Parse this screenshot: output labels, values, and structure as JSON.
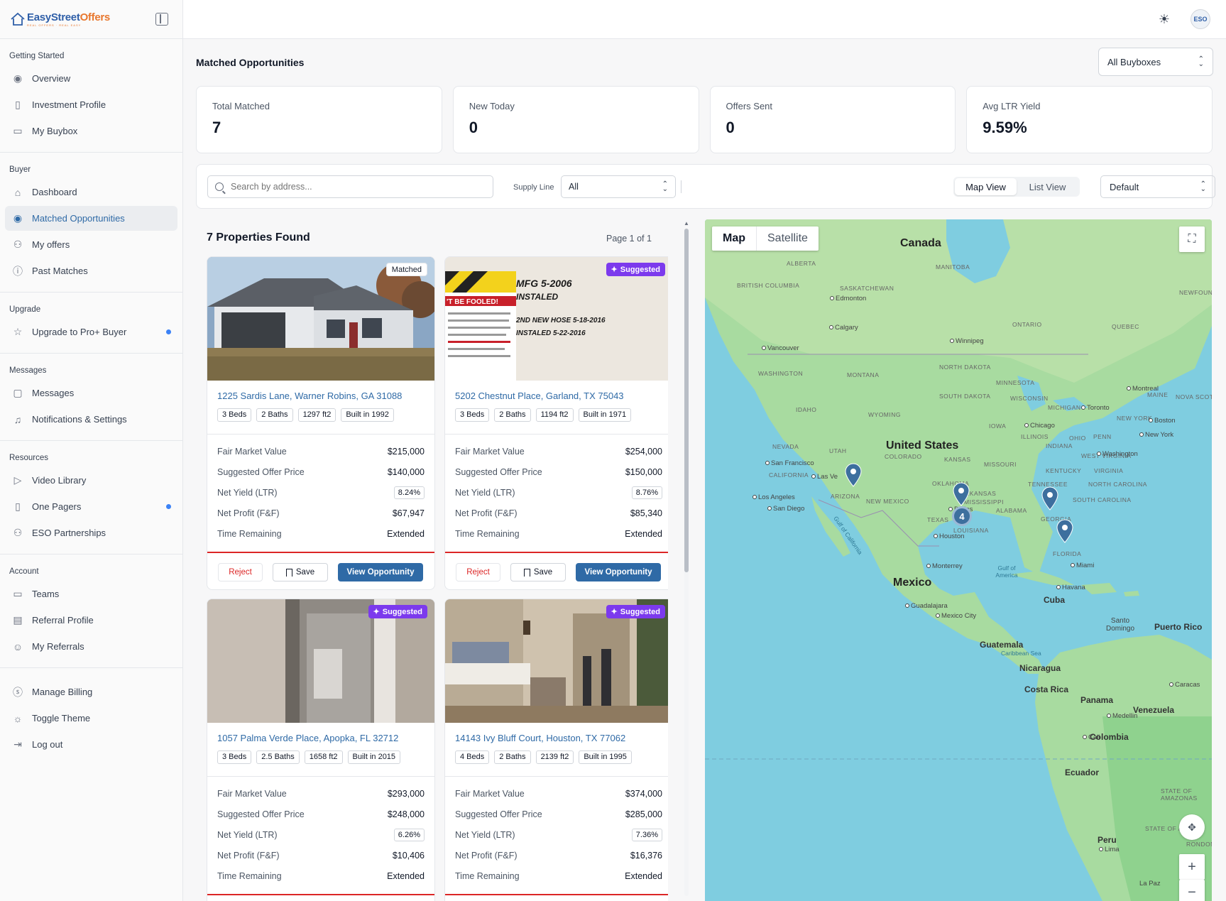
{
  "app": {
    "logo_text_a": "EasyStreet",
    "logo_text_b": "Offers",
    "logo_tagline": "REAL OFFERS · REAL EASY",
    "avatar_text": "ESO"
  },
  "sidebar": {
    "sections": [
      {
        "title": "Getting Started",
        "items": [
          {
            "label": "Overview",
            "icon": "eye-icon"
          },
          {
            "label": "Investment Profile",
            "icon": "book-icon"
          },
          {
            "label": "My Buybox",
            "icon": "briefcase-icon"
          }
        ]
      },
      {
        "title": "Buyer",
        "items": [
          {
            "label": "Dashboard",
            "icon": "home-icon"
          },
          {
            "label": "Matched Opportunities",
            "icon": "eye-icon",
            "active": true
          },
          {
            "label": "My offers",
            "icon": "handshake-icon"
          },
          {
            "label": "Past Matches",
            "icon": "alert-circle-icon"
          }
        ]
      },
      {
        "title": "Upgrade",
        "items": [
          {
            "label": "Upgrade to Pro+ Buyer",
            "icon": "star-icon",
            "dot": true
          }
        ]
      },
      {
        "title": "Messages",
        "items": [
          {
            "label": "Messages",
            "icon": "message-icon"
          },
          {
            "label": "Notifications & Settings",
            "icon": "bell-icon"
          }
        ]
      },
      {
        "title": "Resources",
        "items": [
          {
            "label": "Video Library",
            "icon": "play-icon"
          },
          {
            "label": "One Pagers",
            "icon": "book-icon",
            "dot": true
          },
          {
            "label": "ESO Partnerships",
            "icon": "handshake-icon"
          }
        ]
      },
      {
        "title": "Account",
        "items": [
          {
            "label": "Teams",
            "icon": "briefcase-icon"
          },
          {
            "label": "Referral Profile",
            "icon": "id-badge-icon"
          },
          {
            "label": "My Referrals",
            "icon": "users-icon"
          }
        ]
      }
    ],
    "bottom": [
      {
        "label": "Manage Billing",
        "icon": "dollar-icon"
      },
      {
        "label": "Toggle Theme",
        "icon": "sun-icon"
      },
      {
        "label": "Log out",
        "icon": "logout-icon"
      }
    ]
  },
  "main": {
    "title": "Matched Opportunities",
    "buybox_select": "All Buyboxes",
    "stats": [
      {
        "label": "Total Matched",
        "value": "7"
      },
      {
        "label": "New Today",
        "value": "0"
      },
      {
        "label": "Offers Sent",
        "value": "0"
      },
      {
        "label": "Avg LTR Yield",
        "value": "9.59%"
      }
    ],
    "filters": {
      "search_placeholder": "Search by address...",
      "supply_label": "Supply Line",
      "supply_value": "All",
      "map_view": "Map View",
      "list_view": "List View",
      "sort_value": "Default"
    },
    "found_text": "7 Properties Found",
    "page_text": "Page 1 of 1",
    "labels": {
      "fmv": "Fair Market Value",
      "offer": "Suggested Offer Price",
      "yield": "Net Yield (LTR)",
      "profit": "Net Profit (F&F)",
      "time": "Time Remaining",
      "reject": "Reject",
      "save": "Save",
      "view": "View Opportunity"
    },
    "properties": [
      {
        "badge": "Matched",
        "address": "1225 Sardis Lane, Warner Robins, GA 31088",
        "beds": "3 Beds",
        "baths": "2 Baths",
        "sqft": "1297 ft2",
        "built": "Built in 1992",
        "fmv": "$215,000",
        "offer": "$140,000",
        "yield": "8.24%",
        "profit": "$67,947",
        "time": "Extended"
      },
      {
        "badge": "Suggested",
        "address": "5202 Chestnut Place, Garland, TX 75043",
        "beds": "3 Beds",
        "baths": "2 Baths",
        "sqft": "1194 ft2",
        "built": "Built in 1971",
        "fmv": "$254,000",
        "offer": "$150,000",
        "yield": "8.76%",
        "profit": "$85,340",
        "time": "Extended"
      },
      {
        "badge": "Suggested",
        "address": "1057 Palma Verde Place, Apopka, FL 32712",
        "beds": "3 Beds",
        "baths": "2.5 Baths",
        "sqft": "1658 ft2",
        "built": "Built in 2015",
        "fmv": "$293,000",
        "offer": "$248,000",
        "yield": "6.26%",
        "profit": "$10,406",
        "time": "Extended"
      },
      {
        "badge": "Suggested",
        "address": "14143 Ivy Bluff Court, Houston, TX 77062",
        "beds": "4 Beds",
        "baths": "2 Baths",
        "sqft": "2139 ft2",
        "built": "Built in 1995",
        "fmv": "$374,000",
        "offer": "$285,000",
        "yield": "7.36%",
        "profit": "$16,376",
        "time": "Extended"
      }
    ],
    "photo_text": {
      "sign_left": "'T BE FOOLED!",
      "sign_right_1": "MFG 5-2006",
      "sign_right_2": "INSTALED",
      "sign_right_3": "2ND NEW HOSE 5-18-2016",
      "sign_right_4": "INSTALED 5-22-2016"
    }
  },
  "map": {
    "type_map": "Map",
    "type_satellite": "Satellite",
    "cluster_count": "4",
    "countries": [
      "Canada",
      "United States",
      "Mexico"
    ],
    "labels": {
      "british_columbia": "BRITISH COLUMBIA",
      "alberta": "ALBERTA",
      "saskatchewan": "SASKATCHEWAN",
      "manitoba": "MANITOBA",
      "ontario": "ONTARIO",
      "quebec": "QUEBEC",
      "newfoundland": "NEWFOUND LA",
      "washington": "WASHINGTON",
      "montana": "MONTANA",
      "north_dakota": "NORTH DAKOTA",
      "minnesota": "MINNESOTA",
      "south_dakota": "SOUTH DAKOTA",
      "wisconsin": "WISCONSIN",
      "michigan": "MICHIGAN",
      "maine": "MAINE",
      "nova_scotia": "NOVA SCOT",
      "idaho": "IDAHO",
      "wyoming": "WYOMING",
      "iowa": "IOWA",
      "illinois": "ILLINOIS",
      "indiana": "INDIANA",
      "ohio": "OHIO",
      "penn": "PENN",
      "new_york": "NEW YORK",
      "nevada": "NEVADA",
      "utah": "UTAH",
      "colorado": "COLORADO",
      "kansas": "KANSAS",
      "california": "CALIFORNIA",
      "missouri": "MISSOURI",
      "kentucky": "KENTUCKY",
      "west_virginia": "WEST VIRGINIA",
      "virginia": "VIRGINIA",
      "arizona": "ARIZONA",
      "new_mexico": "NEW MEXICO",
      "oklahoma": "OKLAHOMA",
      "arkansas": "ARKANSAS",
      "tennessee": "TENNESSEE",
      "north_carolina": "NORTH CAROLINA",
      "south_carolina": "SOUTH CAROLINA",
      "mississippi": "MISSISSIPPI",
      "alabama": "ALABAMA",
      "georgia": "GEORGIA",
      "texas": "TEXAS",
      "louisiana": "LOUISIANA",
      "florida": "FLORIDA",
      "gulf_california": "Gulf of California",
      "gulf_america": "Gulf of America",
      "caribbean": "Caribbean Sea",
      "cuba": "Cuba",
      "santo_domingo": "Santo Domingo",
      "puerto_rico": "Puerto Rico",
      "guatemala": "Guatemala",
      "nicaragua": "Nicaragua",
      "costa_rica": "Costa Rica",
      "panama": "Panama",
      "venezuela": "Venezuela",
      "colombia": "Colombia",
      "ecuador": "Ecuador",
      "peru": "Peru",
      "state_amazonas": "STATE OF AMAZONAS",
      "state_acre": "STATE OF ACRE",
      "rondonia": "RONDONI",
      "la_paz": "La Paz"
    },
    "cities": {
      "edmonton": "Edmonton",
      "calgary": "Calgary",
      "vancouver": "Vancouver",
      "winnipeg": "Winnipeg",
      "montreal": "Montreal",
      "toronto": "Toronto",
      "boston": "Boston",
      "chicago": "Chicago",
      "new_york": "New York",
      "washington": "Washington",
      "san_francisco": "San Francisco",
      "las_vegas": "Las Ve",
      "los_angeles": "Los Angeles",
      "san_diego": "San Diego",
      "dallas": "Dallas",
      "houston": "Houston",
      "miami": "Miami",
      "monterrey": "Monterrey",
      "guadalajara": "Guadalajara",
      "mexico_city": "Mexico City",
      "havana": "Havana",
      "caracas": "Caracas",
      "medellin": "Medellin",
      "cali": "Cali",
      "lima": "Lima"
    }
  }
}
